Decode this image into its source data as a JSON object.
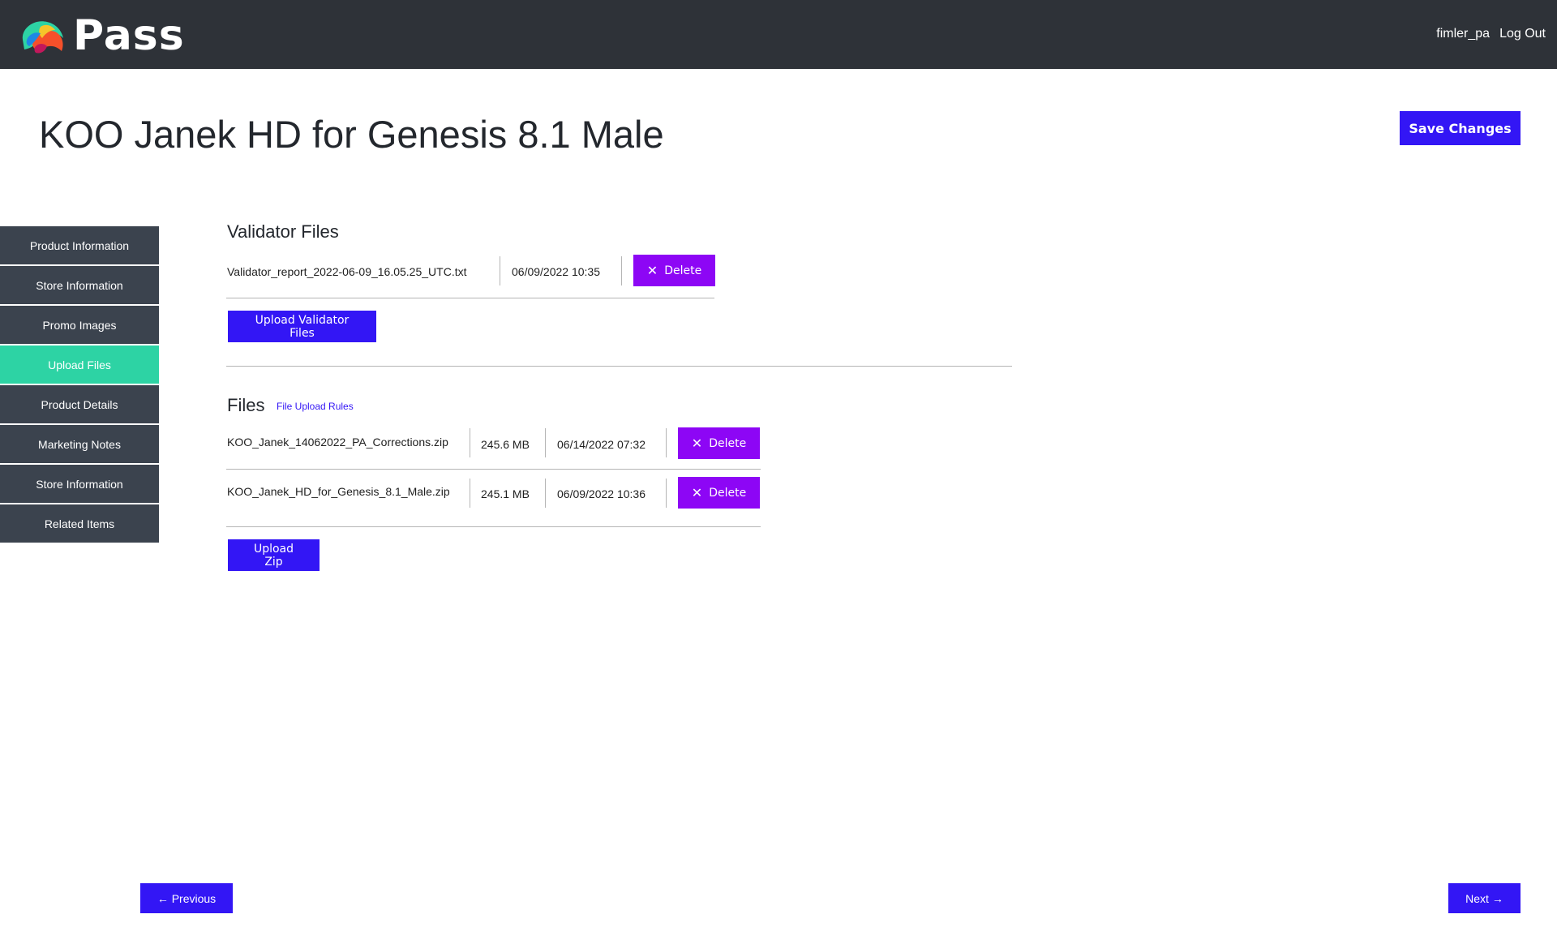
{
  "header": {
    "app_name": "Pass",
    "username": "fimler_pa",
    "logout_label": "Log Out"
  },
  "page": {
    "title": "KOO Janek HD for Genesis 8.1 Male",
    "save_label": "Save Changes"
  },
  "sidebar": {
    "items": [
      {
        "label": "Product Information",
        "active": false
      },
      {
        "label": "Store Information",
        "active": false
      },
      {
        "label": "Promo Images",
        "active": false
      },
      {
        "label": "Upload Files",
        "active": true
      },
      {
        "label": "Product Details",
        "active": false
      },
      {
        "label": "Marketing Notes",
        "active": false
      },
      {
        "label": "Store Information",
        "active": false
      },
      {
        "label": "Related Items",
        "active": false
      }
    ]
  },
  "validator": {
    "title": "Validator Files",
    "file": {
      "name": "Validator_report_2022-06-09_16.05.25_UTC.txt",
      "date": "06/09/2022 10:35"
    },
    "delete_label": "Delete",
    "upload_label": "Upload Validator Files"
  },
  "files": {
    "title": "Files",
    "rules_link": "File Upload Rules",
    "rows": [
      {
        "name": "KOO_Janek_14062022_PA_Corrections.zip",
        "size": "245.6 MB",
        "date": "06/14/2022 07:32"
      },
      {
        "name": "KOO_Janek_HD_for_Genesis_8.1_Male.zip",
        "size": "245.1 MB",
        "date": "06/09/2022 10:36"
      }
    ],
    "delete_label": "Delete",
    "upload_label": "Upload Zip"
  },
  "nav": {
    "previous_label": "← Previous",
    "next_label": "Next →"
  },
  "colors": {
    "header_bg": "#2e3238",
    "sidebar_bg": "#3b434e",
    "sidebar_active": "#2dd3a4",
    "primary_button": "#3316f5",
    "delete_button": "#8d06f5"
  }
}
